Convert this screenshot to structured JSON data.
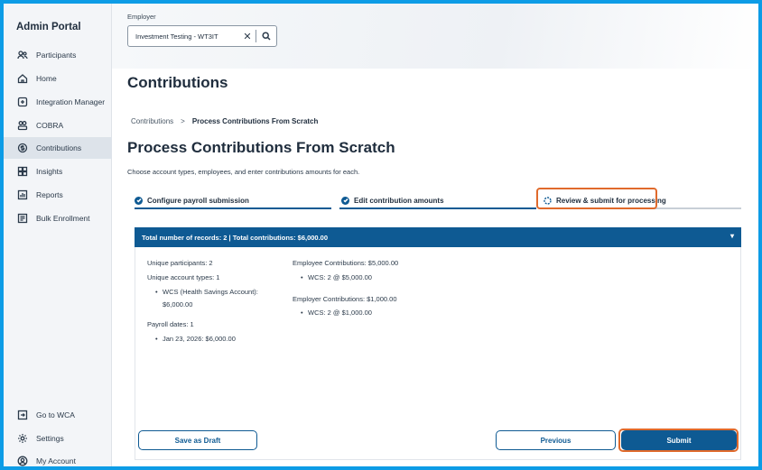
{
  "sidebar": {
    "brand": "Admin Portal",
    "items": [
      {
        "label": "Participants",
        "icon": "people-icon"
      },
      {
        "label": "Home",
        "icon": "home-icon"
      },
      {
        "label": "Integration Manager",
        "icon": "integration-icon"
      },
      {
        "label": "COBRA",
        "icon": "cobra-icon"
      },
      {
        "label": "Contributions",
        "icon": "contributions-icon"
      },
      {
        "label": "Insights",
        "icon": "insights-icon"
      },
      {
        "label": "Reports",
        "icon": "reports-icon"
      },
      {
        "label": "Bulk Enrollment",
        "icon": "bulk-enrollment-icon"
      }
    ],
    "bottom_items": [
      {
        "label": "Go to WCA",
        "icon": "external-icon"
      },
      {
        "label": "Settings",
        "icon": "gear-icon"
      },
      {
        "label": "My Account",
        "icon": "account-icon"
      }
    ],
    "active_index": 4
  },
  "employer": {
    "label": "Employer",
    "value": "Investment Testing - WT3IT",
    "clear_icon": "close-icon",
    "search_icon": "search-icon"
  },
  "page": {
    "title": "Contributions",
    "breadcrumb_root": "Contributions",
    "breadcrumb_sep": ">",
    "breadcrumb_current": "Process Contributions From Scratch",
    "subtitle": "Process Contributions From Scratch",
    "description": "Choose account types, employees, and enter contributions amounts for each."
  },
  "steps": [
    {
      "label": "Configure payroll submission",
      "status": "complete"
    },
    {
      "label": "Edit contribution amounts",
      "status": "complete"
    },
    {
      "label": "Review & submit for processing",
      "status": "current"
    }
  ],
  "summary": {
    "header": "Total number of records: 2 | Total contributions: $6,000.00",
    "unique_participants": "Unique participants: 2",
    "unique_account_types": "Unique account types: 1",
    "account_type_line1": "WCS (Health Savings Account):",
    "account_type_line2": "$6,000.00",
    "payroll_dates": "Payroll dates: 1",
    "payroll_date_item": "Jan 23, 2026: $6,000.00",
    "employee_contributions": "Employee Contributions: $5,000.00",
    "employee_item": "WCS: 2 @ $5,000.00",
    "employer_contributions": "Employer Contributions: $1,000.00",
    "employer_item": "WCS: 2 @ $1,000.00"
  },
  "actions": {
    "save_draft": "Save as Draft",
    "previous": "Previous",
    "submit": "Submit"
  },
  "colors": {
    "primary": "#0e5a93",
    "highlight": "#e06a2c",
    "frame": "#0d9ce6"
  }
}
